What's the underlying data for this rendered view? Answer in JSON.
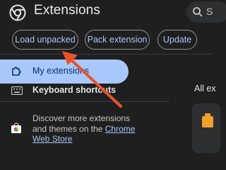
{
  "header": {
    "title": "Extensions",
    "logo": "chrome-logo-icon",
    "search": {
      "icon": "search-icon",
      "text": "S"
    }
  },
  "toolbar": {
    "load_unpacked_label": "Load unpacked",
    "pack_extension_label": "Pack extension",
    "update_label": "Update"
  },
  "sidebar": {
    "items": [
      {
        "label": "My extensions",
        "icon": "puzzle-icon",
        "selected": true
      },
      {
        "label": "Keyboard shortcuts",
        "icon": "keyboard-icon",
        "selected": false
      }
    ],
    "discover": {
      "text": "Discover more extensions and themes on the ",
      "link_label": "Chrome Web Store",
      "icon": "chrome-web-store-icon"
    }
  },
  "main": {
    "all_extensions_label": "All ex"
  },
  "annotation": {
    "icon": "arrow-annotation-icon",
    "color": "#e8542a"
  },
  "colors": {
    "background": "#1f1f1f",
    "accent": "#a8c7fa",
    "selected_text": "#062e6f"
  }
}
